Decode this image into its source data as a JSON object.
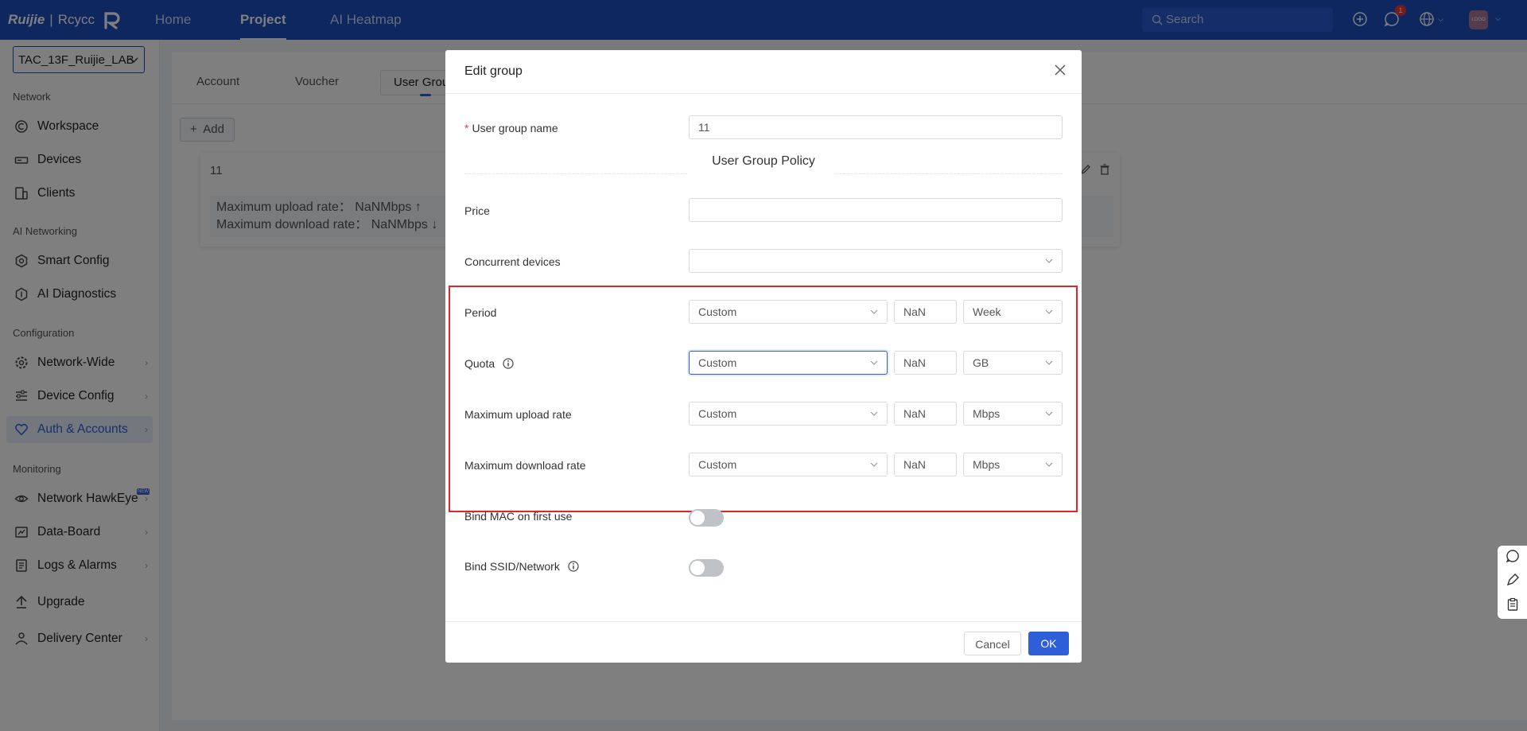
{
  "topbar": {
    "logo_brand": "Ruijie",
    "logo_sep": "|",
    "logo_product": "Rcycc",
    "nav": [
      {
        "label": "Home",
        "active": false
      },
      {
        "label": "Project",
        "active": true
      },
      {
        "label": "AI Heatmap",
        "active": false
      }
    ],
    "search_placeholder": "Search",
    "notification_count": "1",
    "avatar_text": "LOGO",
    "accent_color": "#1f4fbf"
  },
  "sidebar": {
    "site": "TAC_13F_Ruijie_LAB",
    "sections": {
      "network": "Network",
      "ai_networking": "AI Networking",
      "configuration": "Configuration",
      "monitoring": "Monitoring"
    },
    "items": {
      "workspace": "Workspace",
      "devices": "Devices",
      "clients": "Clients",
      "smart_config": "Smart Config",
      "ai_diagnostics": "AI Diagnostics",
      "network_wide": "Network-Wide",
      "device_config": "Device Config",
      "auth_accounts": "Auth & Accounts",
      "network_hawkeye": "Network HawkEye",
      "hawkeye_tag": "NEW",
      "data_board": "Data-Board",
      "logs_alarms": "Logs & Alarms",
      "upgrade": "Upgrade",
      "delivery_center": "Delivery Center"
    }
  },
  "main": {
    "tabs": [
      "Account",
      "Voucher",
      "User Grou"
    ],
    "add_label": "Add",
    "group_card": {
      "name": "11",
      "upload": "Maximum upload rate： NaNMbps ↑",
      "download": "Maximum download rate： NaNMbps ↓"
    }
  },
  "dialog": {
    "title": "Edit group",
    "user_group_name_label": "User group name",
    "user_group_name_value": "11",
    "policy_title": "User Group Policy",
    "price_label": "Price",
    "price_value": "",
    "concurrent_label": "Concurrent devices",
    "concurrent_value": "",
    "period": {
      "label": "Period",
      "mode": "Custom",
      "value": "NaN",
      "unit": "Week"
    },
    "quota": {
      "label": "Quota",
      "mode": "Custom",
      "value": "NaN",
      "unit": "GB"
    },
    "upload": {
      "label": "Maximum upload rate",
      "mode": "Custom",
      "value": "NaN",
      "unit": "Mbps"
    },
    "download": {
      "label": "Maximum download rate",
      "mode": "Custom",
      "value": "NaN",
      "unit": "Mbps"
    },
    "bind_mac_label": "Bind MAC on first use",
    "bind_mac_on": false,
    "bind_ssid_label": "Bind SSID/Network",
    "bind_ssid_on": false,
    "cancel_label": "Cancel",
    "ok_label": "OK",
    "highlight_color": "#e3242b"
  }
}
